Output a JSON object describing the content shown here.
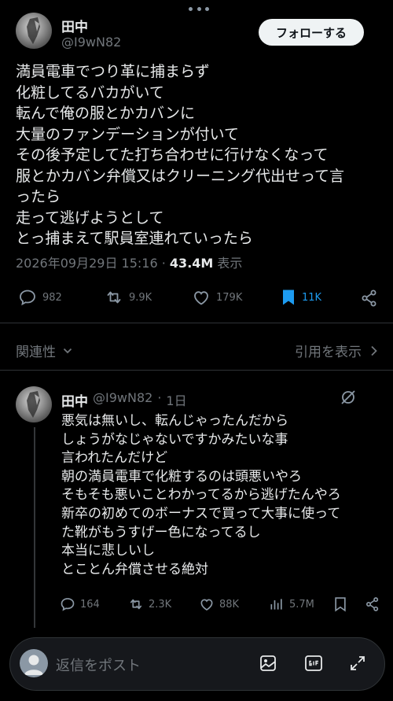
{
  "tweet": {
    "author_name": "田中",
    "author_handle": "@I9wN82",
    "follow_label": "フォローする",
    "lines": [
      "満員電車でつり革に捕まらず",
      "化粧してるバカがいて",
      "転んで俺の服とかカバンに",
      "大量のファンデーションが付いて",
      "その後予定してた打ち合わせに行けなくなって",
      "服とかカバン弁償又はクリーニング代出せって言",
      "ったら",
      "走って逃げようとして",
      "とっ捕まえて駅員室連れていったら"
    ],
    "timestamp": "2026年09月29日 15:16",
    "separator": "·",
    "views_count": "43.4M",
    "views_label": "表示",
    "stats": {
      "replies": "982",
      "retweets": "9.9K",
      "likes": "179K",
      "bookmarks": "11K"
    }
  },
  "sort_label": "関連性",
  "quotes_label": "引用を表示",
  "reply": {
    "author_name": "田中",
    "author_handle": "@I9wN82",
    "time": "1日",
    "separator": "·",
    "lines": [
      "悪気は無いし、転んじゃったんだから",
      "しょうがなじゃないですかみたいな事",
      "言われたんだけど",
      "朝の満員電車で化粧するのは頭悪いやろ",
      "そもそも悪いことわかってるから逃げたんやろ",
      "新卒の初めてのボーナスで買って大事に使って",
      "た靴がもうすげー色になってるし",
      "本当に悲しいし",
      "とことん弁償させる絶対"
    ],
    "stats": {
      "replies": "164",
      "retweets": "2.3K",
      "likes": "88K",
      "views": "5.7M"
    }
  },
  "compose": {
    "placeholder": "返信をポスト"
  },
  "colors": {
    "background": "#000000",
    "text": "#e7e9ea",
    "muted": "#71767b",
    "bookmark_active": "#1d9bf0",
    "follow_button": "#eff3f4"
  },
  "icons": [
    "more-icon",
    "reply-icon",
    "retweet-icon",
    "like-icon",
    "bookmark-icon",
    "share-icon",
    "chevron-down-icon",
    "chevron-right-icon",
    "grok-icon",
    "views-icon",
    "image-icon",
    "gif-icon",
    "expand-icon"
  ]
}
